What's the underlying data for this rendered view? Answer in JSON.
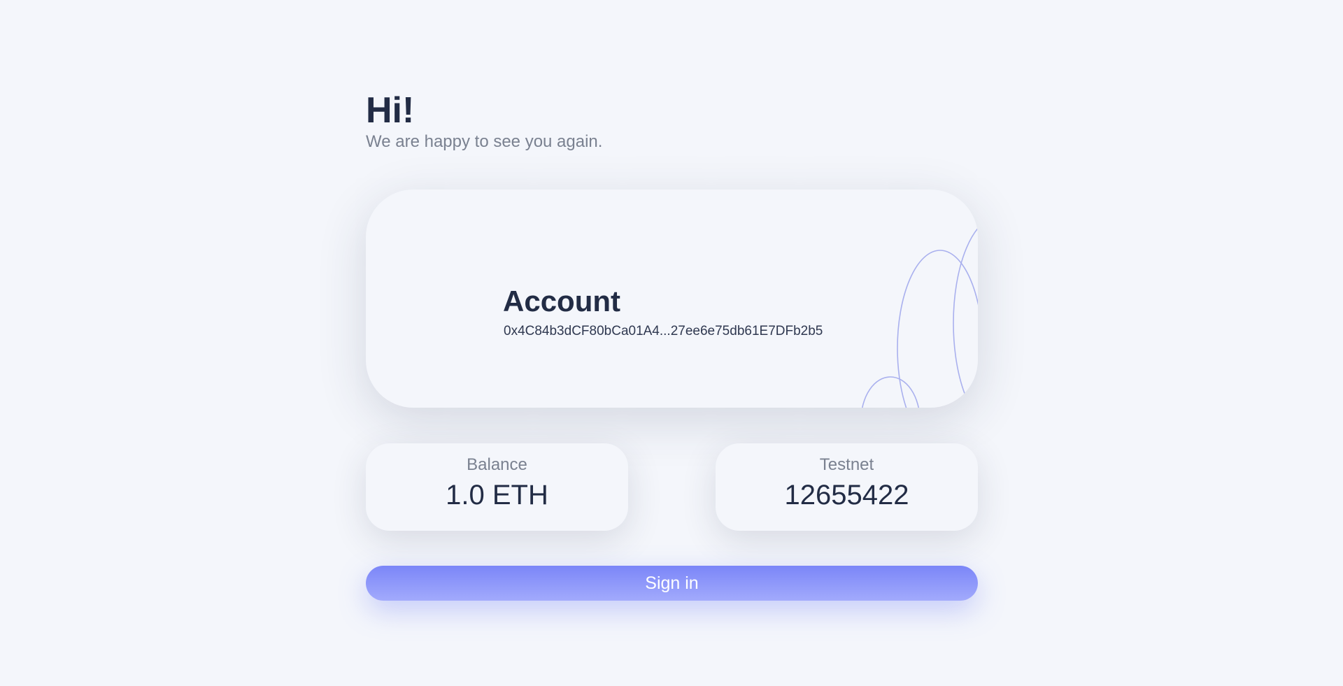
{
  "greeting": {
    "title": "Hi!",
    "subtitle": "We are happy to see you again."
  },
  "account": {
    "title": "Account",
    "address": "0x4C84b3dCF80bCa01A4...27ee6e75db61E7DFb2b5"
  },
  "stats": {
    "balance": {
      "label": "Balance",
      "value": "1.0 ETH"
    },
    "network": {
      "label": "Testnet",
      "value": "12655422"
    }
  },
  "actions": {
    "signin_label": "Sign in"
  },
  "colors": {
    "background": "#f4f6fb",
    "text_primary": "#222c45",
    "text_muted": "#7a8190",
    "accent": "#7b86f8",
    "decor_stroke": "#a9b0ee"
  }
}
